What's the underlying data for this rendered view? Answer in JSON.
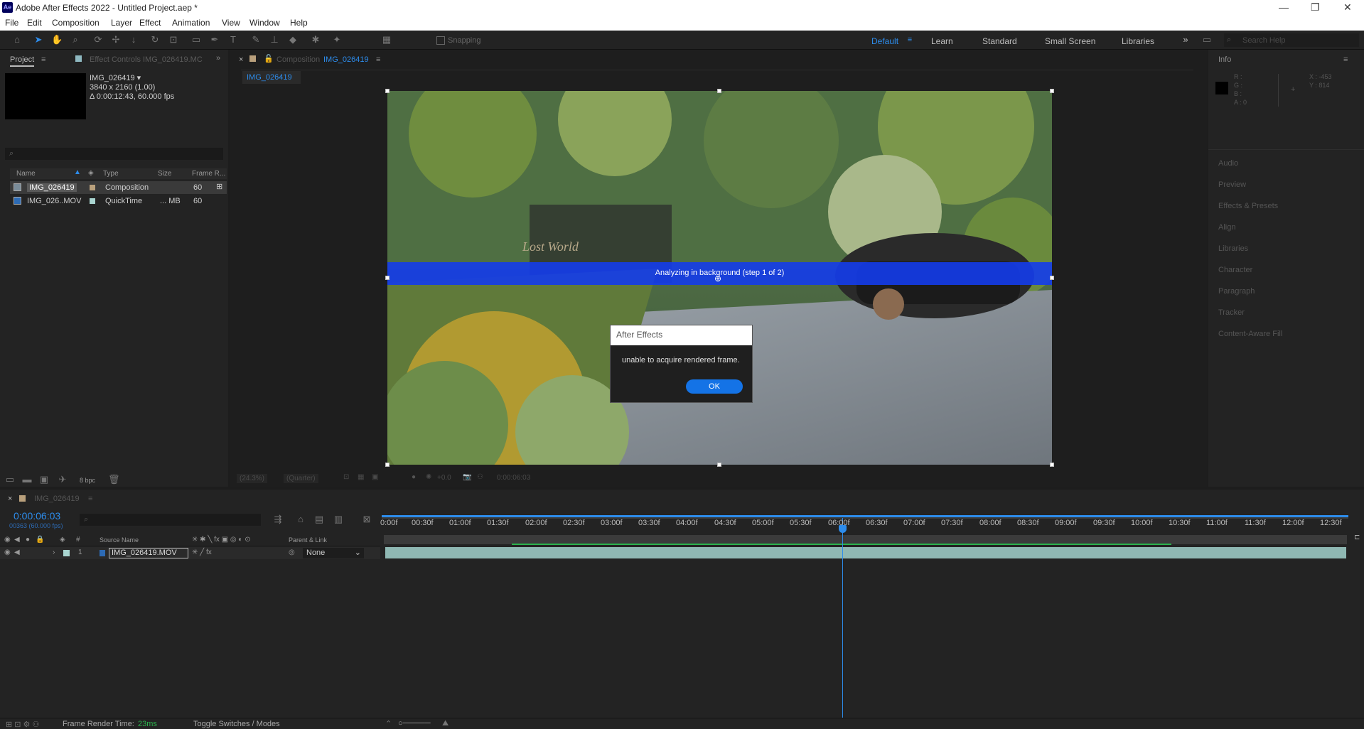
{
  "window": {
    "title": "Adobe After Effects 2022 - Untitled Project.aep *",
    "logo": "Ae"
  },
  "menu": [
    "File",
    "Edit",
    "Composition",
    "Layer",
    "Effect",
    "Animation",
    "View",
    "Window",
    "Help"
  ],
  "toolbar": {
    "snapping": "Snapping",
    "search_placeholder": "Search Help"
  },
  "workspaces": [
    "Default",
    "Learn",
    "Standard",
    "Small Screen",
    "Libraries"
  ],
  "project": {
    "tab": "Project",
    "effect_controls_tab": "Effect Controls IMG_026419.MC",
    "item_name": "IMG_026419 ▾",
    "item_res": "3840 x 2160 (1.00)",
    "item_dur": "Δ 0:00:12:43, 60.000 fps",
    "columns": {
      "name": "Name",
      "type": "Type",
      "size": "Size",
      "rate": "Frame R..."
    },
    "rows": [
      {
        "name": "IMG_026419",
        "type": "Composition",
        "size": "",
        "rate": "60"
      },
      {
        "name": "IMG_026..MOV",
        "type": "QuickTime",
        "size": "... MB",
        "rate": "60"
      }
    ],
    "bpc": "8 bpc"
  },
  "comp": {
    "tab_prefix": "Composition",
    "tab_name": "IMG_026419",
    "sub_tab": "IMG_026419",
    "banner": "Analyzing in background (step 1 of 2)",
    "sign": "Lost World",
    "zoom": "(24.3%)",
    "quality": "(Quarter)",
    "exposure": "+0.0",
    "timecode": "0:00:06:03"
  },
  "dialog": {
    "title": "After Effects",
    "message": "unable to acquire rendered frame.",
    "ok": "OK"
  },
  "right": {
    "info": "Info",
    "r": "R :",
    "g": "G :",
    "b": "B :",
    "a": "A : 0",
    "x": "X : -453",
    "y": "Y : 814",
    "panels": [
      "Audio",
      "Preview",
      "Effects & Presets",
      "Align",
      "Libraries",
      "Character",
      "Paragraph",
      "Tracker",
      "Content-Aware Fill"
    ]
  },
  "timeline": {
    "tab": "IMG_026419",
    "time": "0:00:06:03",
    "frames": "00363 (60.000 fps)",
    "source_name": "Source Name",
    "parent_link": "Parent & Link",
    "layer_num": "1",
    "layer_name": "IMG_026419.MOV",
    "parent": "None",
    "ticks": [
      "0:00f",
      "00:30f",
      "01:00f",
      "01:30f",
      "02:00f",
      "02:30f",
      "03:00f",
      "03:30f",
      "04:00f",
      "04:30f",
      "05:00f",
      "05:30f",
      "06:00f",
      "06:30f",
      "07:00f",
      "07:30f",
      "08:00f",
      "08:30f",
      "09:00f",
      "09:30f",
      "10:00f",
      "10:30f",
      "11:00f",
      "11:30f",
      "12:00f",
      "12:30f"
    ],
    "render_label": "Frame Render Time:",
    "render_value": "23ms",
    "toggle": "Toggle Switches / Modes"
  }
}
